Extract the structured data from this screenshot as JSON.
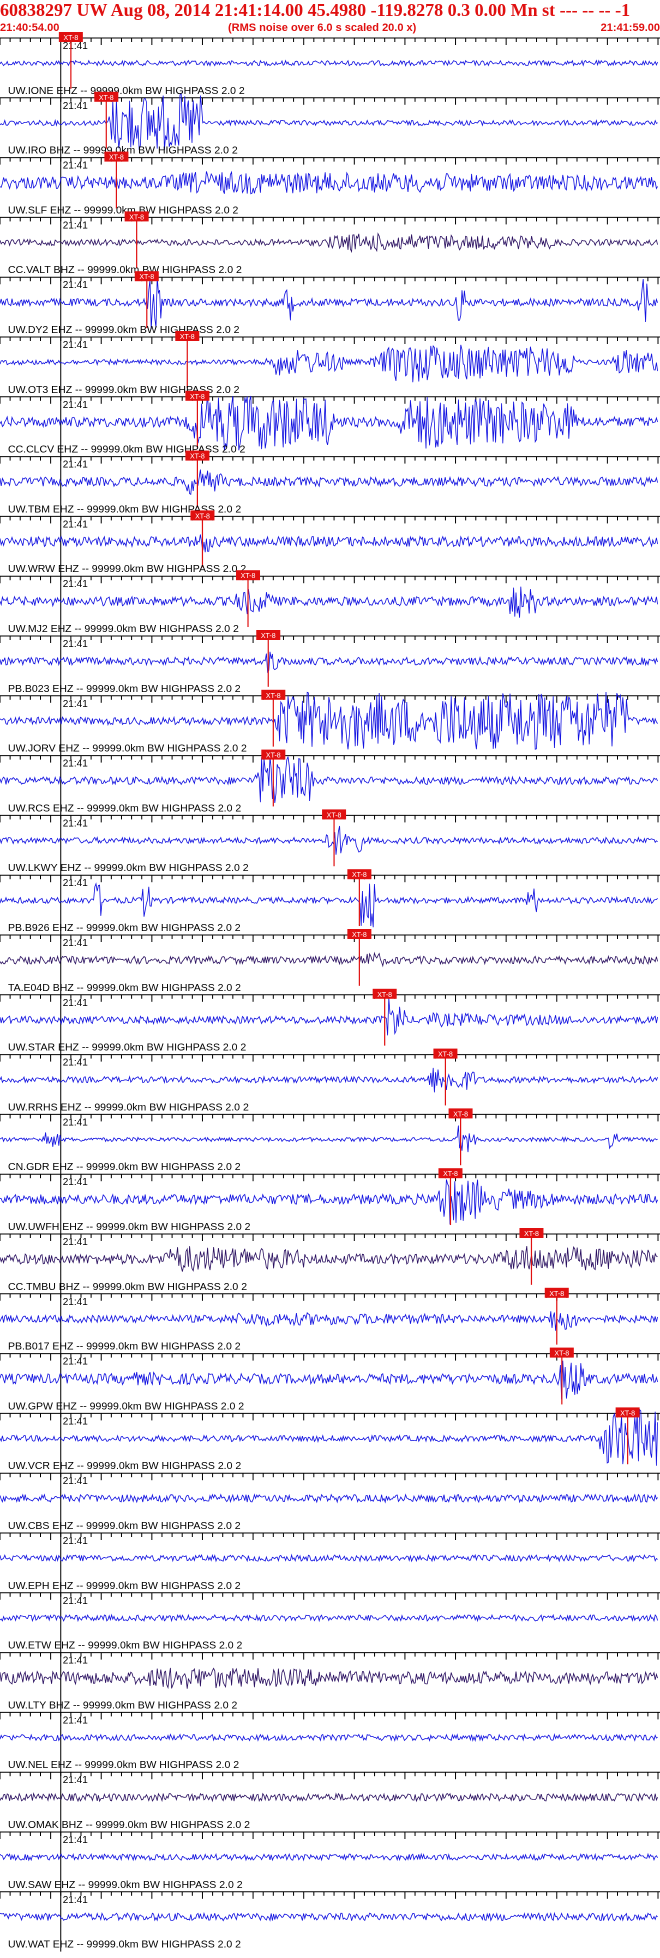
{
  "header": {
    "title": "60838297 UW Aug 08, 2014 21:41:14.00   45.4980 -119.8278  0.3 0.00 Mn st --- -- --   -1",
    "start_time": "21:40:54.00",
    "rms_note": "(RMS noise over 6.0 s scaled 20.0 x)",
    "end_time": "21:41:59.00"
  },
  "colors": {
    "title": "#e01010",
    "trace": "#1010e0",
    "trace_dark": "#2a1060",
    "grid": "#000000",
    "pick_box": "#e01010",
    "pick_line": "#e01010"
  },
  "chart_data": {
    "type": "seismogram",
    "x_start": "21:40:54.00",
    "x_end": "21:41:59.00",
    "x_range_seconds": [
      0,
      65
    ],
    "minute_mark": "21:41",
    "pick_label": "XT-8",
    "traces": [
      {
        "label": "UW.IONE EHZ -- 99999.0km BW  HIGHPASS  2.0  2",
        "pick_s": 7.0,
        "amp": 0.1,
        "color": "blue",
        "bursts": []
      },
      {
        "label": "UW.IRO BHZ -- 99999.0km BW  HIGHPASS  2.0  2",
        "pick_s": 10.5,
        "amp": 0.1,
        "color": "blue",
        "bursts": [
          [
            10.5,
            20,
            2.4
          ]
        ]
      },
      {
        "label": "UW.SLF EHZ -- 99999.0km BW  HIGHPASS  2.0  2",
        "pick_s": 11.5,
        "amp": 0.25,
        "color": "blue",
        "bursts": [
          [
            11.5,
            60,
            0.5
          ]
        ]
      },
      {
        "label": "CC.VALT BHZ -- 99999.0km BW  HIGHPASS  2.0  2",
        "pick_s": 13.5,
        "amp": 0.12,
        "color": "dark",
        "bursts": [
          [
            30,
            55,
            0.4
          ]
        ]
      },
      {
        "label": "UW.DY2 EHZ -- 99999.0km BW  HIGHPASS  2.0  2",
        "pick_s": 14.5,
        "amp": 0.15,
        "color": "blue",
        "bursts": [
          [
            14.5,
            16,
            1.4
          ],
          [
            28,
            29,
            1.0
          ],
          [
            45,
            46,
            0.9
          ],
          [
            63,
            64,
            1.2
          ]
        ]
      },
      {
        "label": "UW.OT3 EHZ -- 99999.0km BW  HIGHPASS  2.0  2",
        "pick_s": 18.5,
        "amp": 0.1,
        "color": "blue",
        "bursts": [
          [
            26,
            34,
            0.6
          ],
          [
            36,
            57,
            0.9
          ],
          [
            60,
            65,
            0.6
          ]
        ]
      },
      {
        "label": "CC.CLCV EHZ -- 99999.0km BW  HIGHPASS  2.0  2",
        "pick_s": 19.5,
        "amp": 0.2,
        "color": "blue",
        "bursts": [
          [
            18,
            33,
            1.5
          ],
          [
            38,
            57,
            1.2
          ]
        ]
      },
      {
        "label": "UW.TBM EHZ -- 99999.0km BW  HIGHPASS  2.0  2",
        "pick_s": 19.5,
        "amp": 0.18,
        "color": "blue",
        "bursts": [
          [
            18,
            22,
            0.6
          ]
        ]
      },
      {
        "label": "UW.WRW EHZ -- 99999.0km BW  HIGHPASS  2.0  2",
        "pick_s": 20.0,
        "amp": 0.2,
        "color": "blue",
        "bursts": [
          [
            19.5,
            21,
            0.6
          ]
        ]
      },
      {
        "label": "UW.MJ2 EHZ -- 99999.0km BW  HIGHPASS  2.0  2",
        "pick_s": 24.5,
        "amp": 0.18,
        "color": "blue",
        "bursts": [
          [
            23,
            27,
            0.6
          ],
          [
            50,
            53,
            0.8
          ]
        ]
      },
      {
        "label": "PB.B023 EHZ -- 99999.0km BW  HIGHPASS  2.0  2",
        "pick_s": 26.5,
        "amp": 0.15,
        "color": "blue",
        "bursts": [
          [
            26,
            28,
            0.5
          ]
        ]
      },
      {
        "label": "UW.JORV EHZ -- 99999.0km BW  HIGHPASS  2.0  2",
        "pick_s": 27.0,
        "amp": 0.15,
        "color": "blue",
        "bursts": [
          [
            27,
            36,
            2.2
          ],
          [
            36,
            42,
            1.3
          ],
          [
            42,
            62,
            2.6
          ]
        ]
      },
      {
        "label": "UW.RCS EHZ -- 99999.0km BW  HIGHPASS  2.0  2",
        "pick_s": 27.0,
        "amp": 0.15,
        "color": "blue",
        "bursts": [
          [
            25,
            31,
            1.3
          ]
        ]
      },
      {
        "label": "UW.LKWY EHZ -- 99999.0km BW  HIGHPASS  2.0  2",
        "pick_s": 33.0,
        "amp": 0.12,
        "color": "blue",
        "bursts": [
          [
            32,
            36,
            0.7
          ]
        ]
      },
      {
        "label": "PB.B926 EHZ -- 99999.0km BW  HIGHPASS  2.0  2",
        "pick_s": 35.5,
        "amp": 0.12,
        "color": "blue",
        "bursts": [
          [
            35.5,
            37,
            1.8
          ],
          [
            9,
            10,
            1.0
          ],
          [
            14,
            15,
            0.8
          ],
          [
            52,
            53,
            0.8
          ]
        ]
      },
      {
        "label": "TA.E04D BHZ -- 99999.0km BW  HIGHPASS  2.0  2",
        "pick_s": 35.5,
        "amp": 0.15,
        "color": "dark",
        "bursts": [
          [
            35.5,
            38,
            0.4
          ]
        ]
      },
      {
        "label": "UW.STAR EHZ -- 99999.0km BW  HIGHPASS  2.0  2",
        "pick_s": 38.0,
        "amp": 0.15,
        "color": "blue",
        "bursts": [
          [
            38,
            40,
            1.0
          ],
          [
            40,
            57,
            0.3
          ]
        ]
      },
      {
        "label": "UW.RRHS EHZ -- 99999.0km BW  HIGHPASS  2.0  2",
        "pick_s": 44.0,
        "amp": 0.12,
        "color": "blue",
        "bursts": [
          [
            42,
            47,
            0.6
          ]
        ]
      },
      {
        "label": "CN.GDR EHZ -- 99999.0km BW  HIGHPASS  2.0  2",
        "pick_s": 45.5,
        "amp": 0.08,
        "color": "blue",
        "bursts": [
          [
            45,
            47,
            0.7
          ],
          [
            4,
            6,
            0.4
          ],
          [
            60,
            61,
            0.4
          ]
        ]
      },
      {
        "label": "UW.UWFH EHZ -- 99999.0km BW  HIGHPASS  2.0  2",
        "pick_s": 44.5,
        "amp": 0.2,
        "color": "blue",
        "bursts": [
          [
            43,
            48,
            1.2
          ],
          [
            48,
            55,
            0.5
          ]
        ]
      },
      {
        "label": "CC.TMBU BHZ -- 99999.0km BW  HIGHPASS  2.0  2",
        "pick_s": 52.5,
        "amp": 0.2,
        "color": "dark",
        "bursts": [
          [
            15,
            30,
            0.6
          ],
          [
            48,
            65,
            0.6
          ]
        ]
      },
      {
        "label": "PB.B017 EHZ -- 99999.0km BW  HIGHPASS  2.0  2",
        "pick_s": 55.0,
        "amp": 0.15,
        "color": "blue",
        "bursts": [
          [
            20,
            45,
            0.3
          ],
          [
            54,
            57,
            0.6
          ]
        ]
      },
      {
        "label": "UW.GPW EHZ -- 99999.0km BW  HIGHPASS  2.0  2",
        "pick_s": 55.5,
        "amp": 0.2,
        "color": "blue",
        "bursts": [
          [
            55,
            58,
            1.0
          ],
          [
            10,
            25,
            0.3
          ]
        ]
      },
      {
        "label": "UW.VCR EHZ -- 99999.0km BW  HIGHPASS  2.0  2",
        "pick_s": 62.0,
        "amp": 0.12,
        "color": "blue",
        "bursts": [
          [
            59,
            65,
            1.8
          ]
        ]
      },
      {
        "label": "UW.CBS EHZ -- 99999.0km BW  HIGHPASS  2.0  2",
        "pick_s": null,
        "amp": 0.15,
        "color": "blue",
        "bursts": []
      },
      {
        "label": "UW.EPH EHZ -- 99999.0km BW  HIGHPASS  2.0  2",
        "pick_s": null,
        "amp": 0.12,
        "color": "blue",
        "bursts": []
      },
      {
        "label": "UW.ETW EHZ -- 99999.0km BW  HIGHPASS  2.0  2",
        "pick_s": null,
        "amp": 0.12,
        "color": "blue",
        "bursts": []
      },
      {
        "label": "UW.LTY BHZ -- 99999.0km BW  HIGHPASS  2.0  2",
        "pick_s": null,
        "amp": 0.25,
        "color": "dark",
        "bursts": [
          [
            12,
            35,
            0.5
          ]
        ]
      },
      {
        "label": "UW.NEL EHZ -- 99999.0km BW  HIGHPASS  2.0  2",
        "pick_s": null,
        "amp": 0.12,
        "color": "blue",
        "bursts": []
      },
      {
        "label": "UW.OMAK BHZ -- 99999.0km BW  HIGHPASS  2.0  2",
        "pick_s": null,
        "amp": 0.15,
        "color": "dark",
        "bursts": []
      },
      {
        "label": "UW.SAW EHZ -- 99999.0km BW  HIGHPASS  2.0  2",
        "pick_s": null,
        "amp": 0.12,
        "color": "blue",
        "bursts": []
      },
      {
        "label": "UW.WAT EHZ -- 99999.0km BW  HIGHPASS  2.0  2",
        "pick_s": null,
        "amp": 0.15,
        "color": "blue",
        "bursts": []
      }
    ]
  }
}
